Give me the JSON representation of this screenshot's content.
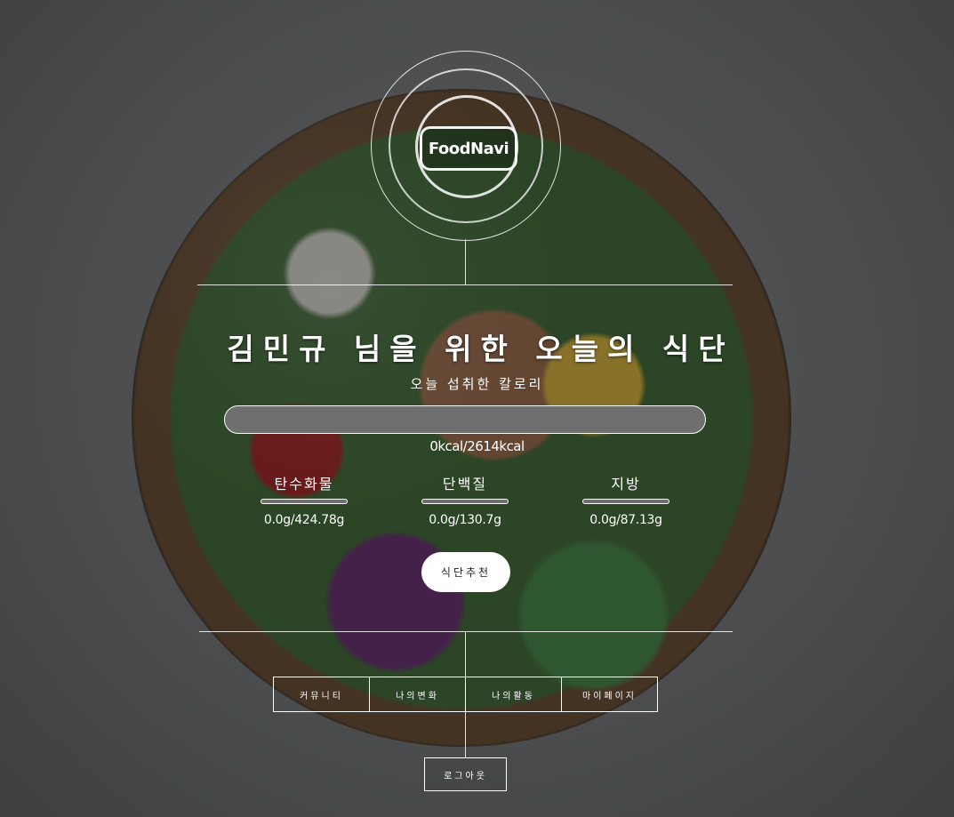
{
  "brand": {
    "name": "FoodNavi"
  },
  "header": {
    "title": "김민규 님을 위한 오늘의 식단",
    "subtitle": "오늘 섭취한 칼로리"
  },
  "calories": {
    "text": "0kcal/2614kcal",
    "consumed": 0,
    "target": 2614,
    "progress": 0
  },
  "macros": [
    {
      "label": "탄수화물",
      "value": "0.0g/424.78g",
      "progress": 0
    },
    {
      "label": "단백질",
      "value": "0.0g/130.7g",
      "progress": 0
    },
    {
      "label": "지방",
      "value": "0.0g/87.13g",
      "progress": 0
    }
  ],
  "actions": {
    "recommend_label": "식단추천",
    "logout_label": "로그아웃"
  },
  "nav": {
    "items": [
      {
        "label": "커뮤니티"
      },
      {
        "label": "나의변화"
      },
      {
        "label": "나의활동"
      },
      {
        "label": "마이페이지"
      }
    ]
  },
  "colors": {
    "progress_fill": "#9ad36a",
    "bar_track": "#6f6f6f"
  }
}
